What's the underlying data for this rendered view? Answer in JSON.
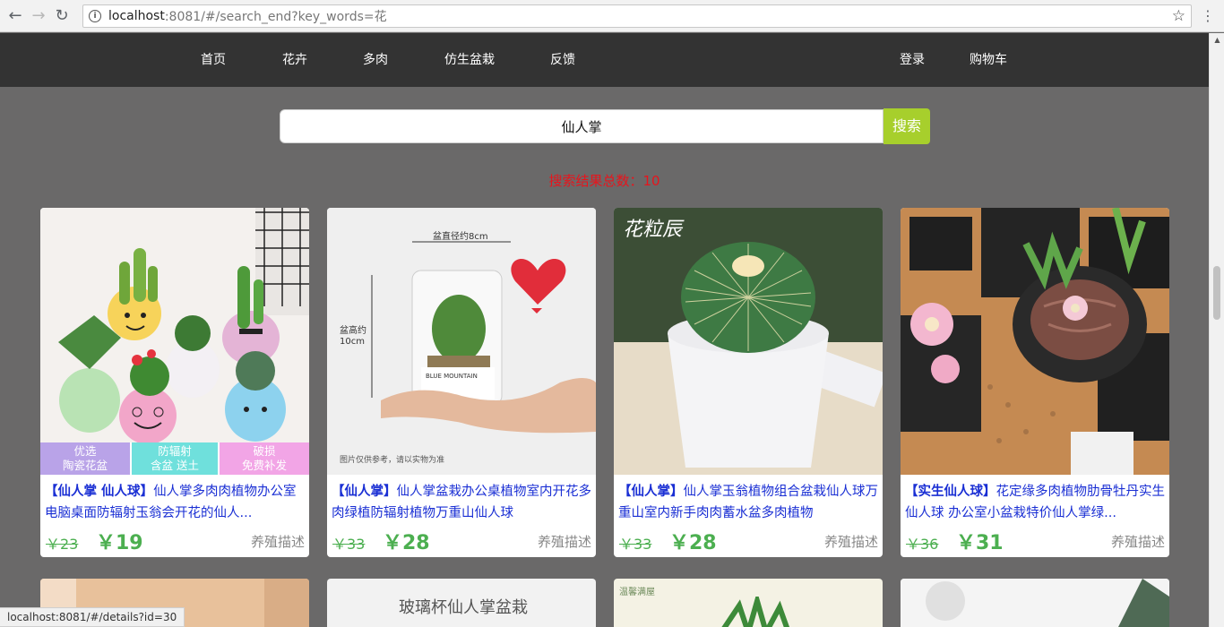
{
  "browser": {
    "url_host": "localhost",
    "url_rest": ":8081/#/search_end?key_words=花",
    "status_url": "localhost:8081/#/details?id=30"
  },
  "nav": {
    "home": "首页",
    "flowers": "花卉",
    "succulents": "多肉",
    "artificial": "仿生盆栽",
    "feedback": "反馈",
    "login": "登录",
    "cart": "购物车"
  },
  "search": {
    "value": "仙人掌",
    "button_label": "搜索",
    "result_count_label": "搜索结果总数：",
    "result_count": "10"
  },
  "products": [
    {
      "tag": "【仙人掌 仙人球】",
      "title": "仙人掌多肉肉植物办公室电脑桌面防辐射玉翁会开花的仙人...",
      "old_price": "￥23",
      "price": "￥19",
      "care": "养殖描述",
      "badges": [
        "优选\n陶瓷花盆",
        "防辐射\n含盆 送土",
        "破损\n免费补发"
      ]
    },
    {
      "tag": "【仙人掌】",
      "title": "仙人掌盆栽办公桌植物室内开花多肉绿植防辐射植物万重山仙人球",
      "old_price": "￥33",
      "price": "￥28",
      "care": "养殖描述",
      "img_texts": [
        "盆直径约8cm",
        "盆高约\n10cm",
        "图片仅供参考，请以实物为准",
        "BLUE MOUNTAIN"
      ]
    },
    {
      "tag": "【仙人掌】",
      "title": "仙人掌玉翁植物组合盆栽仙人球万重山室内新手肉肉蓄水盆多肉植物",
      "old_price": "￥33",
      "price": "￥28",
      "care": "养殖描述",
      "img_texts": [
        "花粒辰"
      ]
    },
    {
      "tag": "【实生仙人球】",
      "title": "花定缘多肉植物肋骨牡丹实生仙人球 办公室小盆栽特价仙人掌绿...",
      "old_price": "￥36",
      "price": "￥31",
      "care": "养殖描述"
    }
  ],
  "row2": {
    "card2_text": "玻璃杯仙人掌盆栽",
    "card3_text": "温馨满屋"
  },
  "colors": {
    "header_bg": "#333333",
    "page_bg": "#6a6969",
    "accent_green": "#a7cf2c",
    "price_green": "#4caf50",
    "title_blue": "#1a2fd4",
    "count_red": "#e8141c"
  }
}
